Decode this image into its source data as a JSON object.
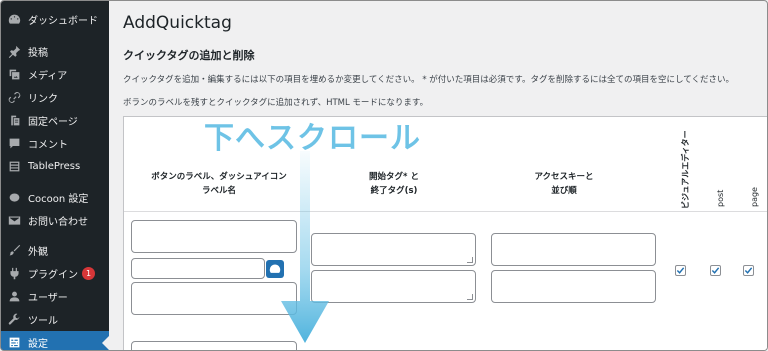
{
  "sidebar": {
    "items": [
      {
        "label": "ダッシュボード",
        "icon": "dashboard-icon"
      },
      {
        "label": "投稿",
        "icon": "pin-icon"
      },
      {
        "label": "メディア",
        "icon": "media-icon"
      },
      {
        "label": "リンク",
        "icon": "link-icon"
      },
      {
        "label": "固定ページ",
        "icon": "page-icon"
      },
      {
        "label": "コメント",
        "icon": "comment-icon"
      },
      {
        "label": "TablePress",
        "icon": "table-icon"
      },
      {
        "label": "Cocoon 設定",
        "icon": "cocoon-icon"
      },
      {
        "label": "お問い合わせ",
        "icon": "mail-icon"
      },
      {
        "label": "外観",
        "icon": "brush-icon"
      },
      {
        "label": "プラグイン",
        "icon": "plugin-icon",
        "badge": "1"
      },
      {
        "label": "ユーザー",
        "icon": "user-icon"
      },
      {
        "label": "ツール",
        "icon": "wrench-icon"
      },
      {
        "label": "設定",
        "icon": "settings-icon"
      }
    ]
  },
  "main": {
    "title": "AddQuicktag",
    "section_title": "クイックタグの追加と削除",
    "desc_line1": "クイックタグを追加・編集するには以下の項目を埋めるか変更してください。 * が付いた項目は必須です。タグを削除するには全ての項目を空にしてください。",
    "desc_line2": "ボランのラベルを残すとクイックタグに追加されず、HTML モードになります。"
  },
  "table": {
    "col_button_label": "ボタンのラベル、ダッシュアイコン",
    "col_button_label2": "ラベル名",
    "col_tag_line1": "開始タグ* と",
    "col_tag_line2": "終了タグ(s)",
    "col_access_line1": "アクセスキーと",
    "col_access_line2": "並び順",
    "col_visual": "ビジュアルエディター",
    "col_post": "post",
    "col_page": "page"
  },
  "overlay": {
    "scroll_hint": "下へスクロール"
  },
  "colors": {
    "sidebar_bg": "#1d2327",
    "active_bg": "#2271b1",
    "overlay_text": "#6ec3e6",
    "checkbox_check": "#2271b1"
  }
}
